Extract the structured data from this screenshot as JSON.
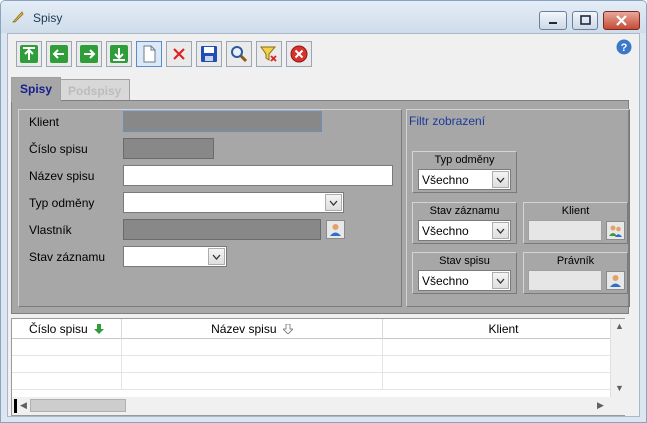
{
  "window": {
    "title": "Spisy"
  },
  "toolbar": {
    "buttons": [
      {
        "name": "first-record-button",
        "icon": "arrow-up-icon"
      },
      {
        "name": "previous-record-button",
        "icon": "arrow-left-icon"
      },
      {
        "name": "next-record-button",
        "icon": "arrow-right-icon"
      },
      {
        "name": "last-record-button",
        "icon": "arrow-down-icon"
      },
      {
        "name": "new-record-button",
        "icon": "new-document-icon"
      },
      {
        "name": "delete-record-button",
        "icon": "delete-x-icon"
      },
      {
        "name": "save-button",
        "icon": "floppy-disk-icon"
      },
      {
        "name": "search-button",
        "icon": "magnifier-icon"
      },
      {
        "name": "clear-filter-button",
        "icon": "filter-clear-icon"
      },
      {
        "name": "close-form-button",
        "icon": "red-circle-x-icon"
      }
    ]
  },
  "tabs": {
    "active": "Spisy",
    "inactive": "Podspisy"
  },
  "form": {
    "klient_label": "Klient",
    "cislo_label": "Číslo spisu",
    "nazev_label": "Název spisu",
    "typ_label": "Typ odměny",
    "vlastnik_label": "Vlastník",
    "stav_label": "Stav záznamu",
    "nazev_value": "",
    "typ_value": "",
    "stav_value": ""
  },
  "filter": {
    "title": "Filtr zobrazení",
    "typ_odmeny": {
      "caption": "Typ odměny",
      "value": "Všechno"
    },
    "stav_zaznamu": {
      "caption": "Stav záznamu",
      "value": "Všechno"
    },
    "stav_spisu": {
      "caption": "Stav spisu",
      "value": "Všechno"
    },
    "klient": {
      "caption": "Klient"
    },
    "pravnik": {
      "caption": "Právník"
    }
  },
  "grid": {
    "columns": [
      "Číslo spisu",
      "Název spisu",
      "Klient"
    ]
  },
  "colors": {
    "accent": "#1d3a9a",
    "tab_active_text": "#15208a",
    "disabled_field": "#888888"
  }
}
